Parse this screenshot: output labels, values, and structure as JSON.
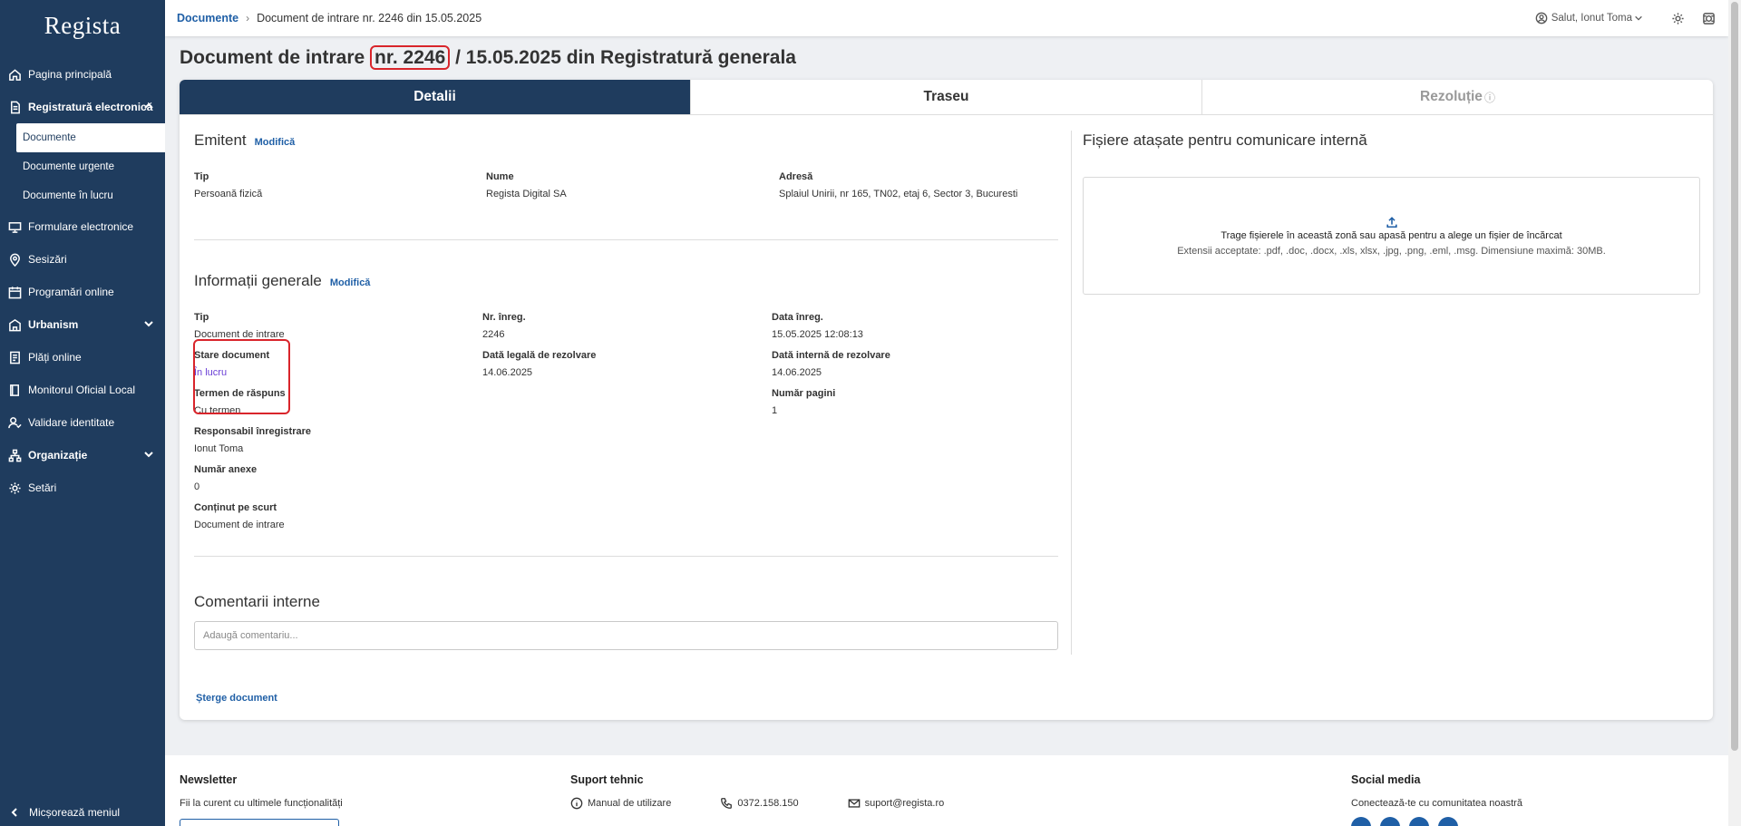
{
  "app": {
    "logo": "Regista"
  },
  "sidebar": {
    "items": [
      {
        "label": "Pagina principală"
      },
      {
        "label": "Registratură electronică"
      },
      {
        "label": "Formulare electronice"
      },
      {
        "label": "Sesizări"
      },
      {
        "label": "Programări online"
      },
      {
        "label": "Urbanism"
      },
      {
        "label": "Plăți online"
      },
      {
        "label": "Monitorul Oficial Local"
      },
      {
        "label": "Validare identitate"
      },
      {
        "label": "Organizație"
      },
      {
        "label": "Setări"
      }
    ],
    "sub_items": [
      {
        "label": "Documente"
      },
      {
        "label": "Documente urgente"
      },
      {
        "label": "Documente în lucru"
      }
    ],
    "collapse_label": "Micșorează meniul"
  },
  "topbar": {
    "breadcrumb_root": "Documente",
    "breadcrumb_sep": "›",
    "breadcrumb_current": "Document de intrare nr. 2246 din 15.05.2025",
    "user_greeting": "Salut, Ionut Toma"
  },
  "title": {
    "prefix": "Document de intrare ",
    "number": "nr. 2246",
    "suffix": " / 15.05.2025 din Registratură generala"
  },
  "tabs": [
    {
      "label": "Detalii"
    },
    {
      "label": "Traseu"
    },
    {
      "label": "Rezoluție",
      "icon": "ⓘ"
    }
  ],
  "emitent": {
    "title": "Emitent",
    "modify": "Modifică",
    "fields": [
      {
        "label": "Tip",
        "value": "Persoană fizică"
      },
      {
        "label": "Nume",
        "value": "Regista Digital SA"
      },
      {
        "label": "Adresă",
        "value": "Splaiul Unirii, nr 165, TN02, etaj 6, Sector 3, Bucuresti"
      }
    ]
  },
  "info": {
    "title": "Informații generale",
    "modify": "Modifică",
    "tip": {
      "label": "Tip",
      "value": "Document de intrare"
    },
    "nr_inreg": {
      "label": "Nr. înreg.",
      "value": "2246"
    },
    "data_inreg": {
      "label": "Data înreg.",
      "value": "15.05.2025 12:08:13"
    },
    "stare": {
      "label": "Stare document",
      "value": "În lucru"
    },
    "data_legala": {
      "label": "Dată legală de rezolvare",
      "value": "14.06.2025"
    },
    "data_interna": {
      "label": "Dată internă de rezolvare",
      "value": "14.06.2025"
    },
    "termen": {
      "label": "Termen de răspuns",
      "value": "Cu termen"
    },
    "pagini": {
      "label": "Număr pagini",
      "value": "1"
    },
    "responsabil": {
      "label": "Responsabil înregistrare",
      "value": "Ionut Toma"
    },
    "anexe": {
      "label": "Număr anexe",
      "value": "0"
    },
    "continut": {
      "label": "Conținut pe scurt",
      "value": "Document de intrare"
    }
  },
  "comments": {
    "title": "Comentarii interne",
    "placeholder": "Adaugă comentariu..."
  },
  "delete_label": "Șterge document",
  "attachments": {
    "title": "Fișiere atașate pentru comunicare internă",
    "drop_text": "Trage fișierele în această zonă sau apasă pentru a alege un fișier de încărcat",
    "drop_hint": "Extensii acceptate: .pdf, .doc, .docx, .xls, xlsx, .jpg, .png, .eml, .msg. Dimensiune maximă: 30MB."
  },
  "footer": {
    "newsletter_title": "Newsletter",
    "newsletter_text": "Fii la curent cu ultimele funcționalități",
    "support_title": "Suport tehnic",
    "manual": "Manual de utilizare",
    "phone": "0372.158.150",
    "email": "suport@regista.ro",
    "social_title": "Social media",
    "social_text": "Conectează-te cu comunitatea noastră"
  },
  "colors": {
    "sidebar": "#1f3c5e",
    "accent": "#1f5fa6",
    "highlight": "#d9252b",
    "status_link": "#6a3fd6"
  }
}
